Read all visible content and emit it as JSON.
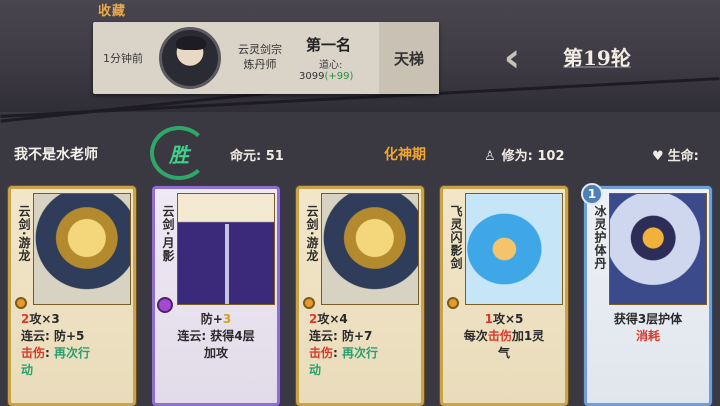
{
  "header": {
    "favorite_label": "收藏",
    "round_label": "第19轮"
  },
  "history_entry": {
    "time": "1分钟前",
    "sect": "云灵剑宗",
    "role": "炼丹师",
    "rank": "第一名",
    "dao_heart_label": "道心:",
    "dao_heart_value": "3099",
    "dao_heart_delta": "(+99)",
    "ladder_label": "天梯"
  },
  "player": {
    "name": "我不是水老师",
    "result": "胜",
    "life_label": "命元: 51",
    "realm": "化神期",
    "cultivation_label": "修为: 102",
    "hp_label": "生命:"
  },
  "cards": [
    {
      "title": "云剑·游龙",
      "lines": [
        {
          "parts": [
            {
              "t": "2",
              "c": "red"
            },
            {
              "t": "攻×3",
              "c": ""
            }
          ]
        },
        {
          "parts": [
            {
              "t": "连云: 防+5",
              "c": ""
            }
          ]
        },
        {
          "parts": [
            {
              "t": "击伤",
              "c": "red"
            },
            {
              "t": ": ",
              "c": ""
            },
            {
              "t": "再次行",
              "c": "green"
            }
          ]
        },
        {
          "parts": [
            {
              "t": "动",
              "c": "green"
            }
          ]
        }
      ]
    },
    {
      "title": "云剑·月影",
      "lines": [
        {
          "parts": [
            {
              "t": "防+",
              "c": ""
            },
            {
              "t": "3",
              "c": "gold"
            }
          ]
        },
        {
          "parts": [
            {
              "t": "连云: 获得4层",
              "c": ""
            }
          ]
        },
        {
          "parts": [
            {
              "t": "加攻",
              "c": ""
            }
          ]
        }
      ]
    },
    {
      "title": "云剑·游龙",
      "lines": [
        {
          "parts": [
            {
              "t": "2",
              "c": "red"
            },
            {
              "t": "攻×4",
              "c": ""
            }
          ]
        },
        {
          "parts": [
            {
              "t": "连云: 防+7",
              "c": ""
            }
          ]
        },
        {
          "parts": [
            {
              "t": "击伤",
              "c": "red"
            },
            {
              "t": ": ",
              "c": ""
            },
            {
              "t": "再次行",
              "c": "green"
            }
          ]
        },
        {
          "parts": [
            {
              "t": "动",
              "c": "green"
            }
          ]
        }
      ]
    },
    {
      "title": "飞灵闪影剑",
      "lines": [
        {
          "parts": [
            {
              "t": "1",
              "c": "red"
            },
            {
              "t": "攻×5",
              "c": ""
            }
          ]
        },
        {
          "parts": [
            {
              "t": "每次",
              "c": ""
            },
            {
              "t": "击伤",
              "c": "red"
            },
            {
              "t": "加1灵",
              "c": ""
            }
          ]
        },
        {
          "parts": [
            {
              "t": "气",
              "c": ""
            }
          ]
        }
      ]
    },
    {
      "title": "冰灵护体丹",
      "level": "1",
      "lines": [
        {
          "parts": [
            {
              "t": "获得3层护体",
              "c": ""
            }
          ]
        },
        {
          "parts": [
            {
              "t": "消耗",
              "c": "red"
            }
          ]
        }
      ]
    }
  ]
}
